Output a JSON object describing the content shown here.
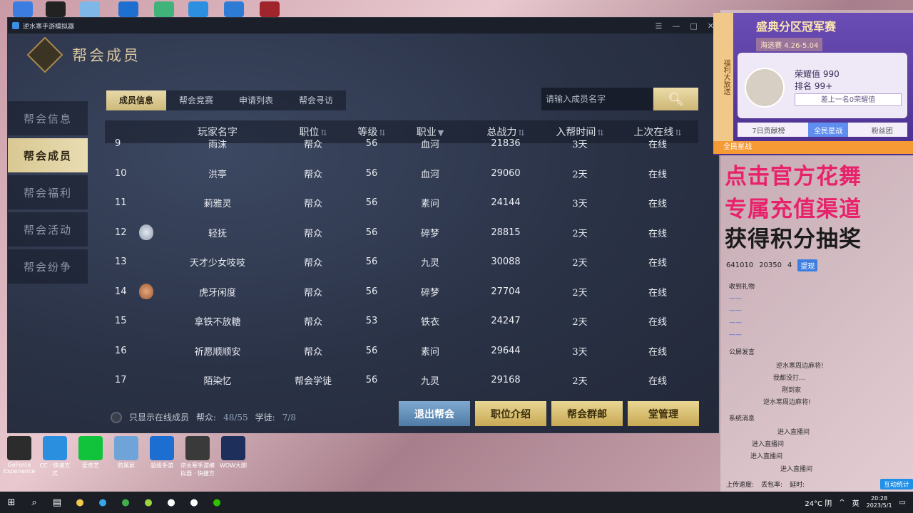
{
  "emulator": {
    "title": "逆水寒手游模拟器",
    "controls": [
      "☰",
      "—",
      "□",
      "✕"
    ]
  },
  "game": {
    "page_title": "帮会成员",
    "side_nav": [
      {
        "label": "帮会信息",
        "active": false
      },
      {
        "label": "帮会成员",
        "active": true
      },
      {
        "label": "帮会福利",
        "active": false
      },
      {
        "label": "帮会活动",
        "active": false
      },
      {
        "label": "帮会纷争",
        "active": false
      }
    ],
    "tabs": [
      {
        "label": "成员信息",
        "active": true
      },
      {
        "label": "帮会竞赛",
        "active": false
      },
      {
        "label": "申请列表",
        "active": false
      },
      {
        "label": "帮会寻访",
        "active": false
      }
    ],
    "search": {
      "placeholder": "请输入成员名字"
    },
    "table": {
      "headers": [
        "玩家名字",
        "职位",
        "等级",
        "职业",
        "总战力",
        "入帮时间",
        "上次在线"
      ],
      "rows": [
        {
          "rank": "9",
          "badge": "",
          "name": "雨沫",
          "pos": "帮众",
          "lvl": "56",
          "job": "血河",
          "power": "21836",
          "join": "3天",
          "online": "在线"
        },
        {
          "rank": "10",
          "badge": "",
          "name": "洪亭",
          "pos": "帮众",
          "lvl": "56",
          "job": "血河",
          "power": "29060",
          "join": "2天",
          "online": "在线"
        },
        {
          "rank": "11",
          "badge": "",
          "name": "莿雅灵",
          "pos": "帮众",
          "lvl": "56",
          "job": "素问",
          "power": "24144",
          "join": "3天",
          "online": "在线"
        },
        {
          "rank": "12",
          "badge": "silver",
          "name": "轻抚",
          "pos": "帮众",
          "lvl": "56",
          "job": "碎梦",
          "power": "28815",
          "join": "2天",
          "online": "在线"
        },
        {
          "rank": "13",
          "badge": "",
          "name": "天才少女吱吱",
          "pos": "帮众",
          "lvl": "56",
          "job": "九灵",
          "power": "30088",
          "join": "2天",
          "online": "在线"
        },
        {
          "rank": "14",
          "badge": "bronze",
          "name": "虎牙闲度",
          "pos": "帮众",
          "lvl": "56",
          "job": "碎梦",
          "power": "27704",
          "join": "2天",
          "online": "在线"
        },
        {
          "rank": "15",
          "badge": "",
          "name": "拿铁不放糖",
          "pos": "帮众",
          "lvl": "53",
          "job": "铁衣",
          "power": "24247",
          "join": "2天",
          "online": "在线"
        },
        {
          "rank": "16",
          "badge": "",
          "name": "祈愿顺顺安",
          "pos": "帮众",
          "lvl": "56",
          "job": "素问",
          "power": "29644",
          "join": "3天",
          "online": "在线"
        },
        {
          "rank": "17",
          "badge": "",
          "name": "陌染忆",
          "pos": "帮会学徒",
          "lvl": "56",
          "job": "九灵",
          "power": "29168",
          "join": "2天",
          "online": "在线"
        }
      ]
    },
    "footer": {
      "online_only": "只显示在线成员",
      "members_label": "帮众:",
      "members_val": "48/55",
      "apprentice_label": "学徒:",
      "apprentice_val": "7/8"
    },
    "buttons": {
      "leave": "退出帮会",
      "positions": "职位介绍",
      "mail": "帮会群邮",
      "manage": "堂管理"
    }
  },
  "live": {
    "promo_side": "福利大放送",
    "promo_title": "盛典分区冠军赛",
    "promo_date": "海选赛 4.26-5.04",
    "honor": "荣耀值 990",
    "rank": "排名 99+",
    "diff": "差上一名0荣耀值",
    "promo_tabs": [
      "7日贡献榜",
      "全民星战",
      "粉丝团"
    ],
    "marquee": "全民星战",
    "ad_lines": [
      "点击官方花舞",
      "专属充值渠道",
      "获得积分抽奖"
    ],
    "stats": {
      "a": "641010",
      "b": "20350",
      "c": "4",
      "recharge": "提现"
    },
    "gift_title": "收到礼物",
    "chat_title": "公屏发言",
    "chat": [
      "逆水寒周边麻将!",
      "我都没打...",
      "刚到家",
      "逆水寒周边麻将!"
    ],
    "sys_title": "系统消息",
    "sys": [
      "进入直播间",
      "进入直播间",
      "进入直播间",
      "进入直播间"
    ],
    "bottom": {
      "upload": "上传速度:",
      "loss": "丢包率:",
      "latency": "延时:",
      "interact": "互动统计"
    }
  },
  "desktop_icons": [
    {
      "label": "GeForce Experience"
    },
    {
      "label": "CC · 快速方式"
    },
    {
      "label": "爱奇艺"
    },
    {
      "label": "防黑屏"
    },
    {
      "label": "超级手游"
    },
    {
      "label": "逆水寒手游模拟器 · 快捷方"
    },
    {
      "label": "WOW大脚"
    }
  ],
  "taskbar": {
    "weather": "24°C 阴",
    "ime": "英",
    "time": "20:28",
    "date": "2023/5/1"
  }
}
